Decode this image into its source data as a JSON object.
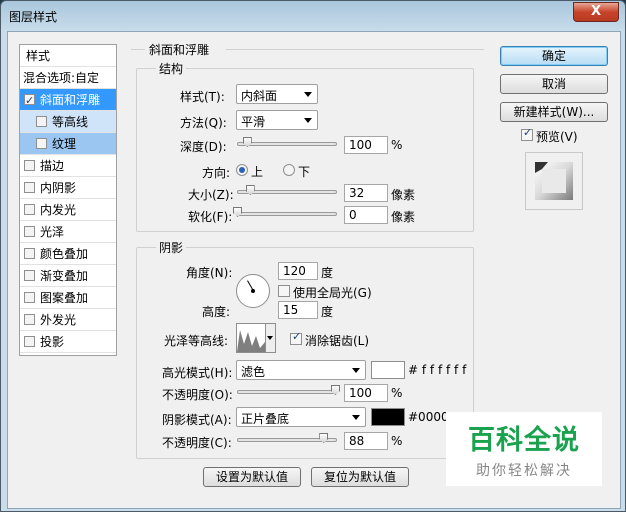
{
  "window": {
    "title": "图层样式",
    "close_label": "X"
  },
  "left_panel": {
    "header": "样式",
    "blend_options": "混合选项:自定",
    "items": [
      {
        "label": "斜面和浮雕",
        "checked": true
      },
      {
        "label": "等高线",
        "checked": false
      },
      {
        "label": "纹理",
        "checked": false
      },
      {
        "label": "描边",
        "checked": false
      },
      {
        "label": "内阴影",
        "checked": false
      },
      {
        "label": "内发光",
        "checked": false
      },
      {
        "label": "光泽",
        "checked": false
      },
      {
        "label": "颜色叠加",
        "checked": false
      },
      {
        "label": "渐变叠加",
        "checked": false
      },
      {
        "label": "图案叠加",
        "checked": false
      },
      {
        "label": "外发光",
        "checked": false
      },
      {
        "label": "投影",
        "checked": false
      }
    ]
  },
  "bevel": {
    "section_title": "斜面和浮雕",
    "structure": {
      "title": "结构",
      "style_label": "样式(T):",
      "style_value": "内斜面",
      "technique_label": "方法(Q):",
      "technique_value": "平滑",
      "depth_label": "深度(D):",
      "depth_value": "100",
      "depth_unit": "%",
      "depth_slider": 0.1,
      "direction_label": "方向:",
      "direction_up": "上",
      "direction_down": "下",
      "direction_selected": "up",
      "size_label": "大小(Z):",
      "size_value": "32",
      "size_unit": "像素",
      "size_slider": 0.13,
      "soften_label": "软化(F):",
      "soften_value": "0",
      "soften_unit": "像素",
      "soften_slider": 0.0
    },
    "shading": {
      "title": "阴影",
      "angle_label": "角度(N):",
      "angle_value": "120",
      "angle_unit": "度",
      "global_light_label": "使用全局光(G)",
      "global_light_checked": false,
      "altitude_label": "高度:",
      "altitude_value": "15",
      "altitude_unit": "度",
      "gloss_contour_label": "光泽等高线:",
      "anti_alias_label": "消除锯齿(L)",
      "anti_alias_checked": true,
      "highlight_mode_label": "高光模式(H):",
      "highlight_mode_value": "滤色",
      "highlight_color": "#ffffff",
      "highlight_color_text": "# f f f f f f",
      "highlight_opacity_label": "不透明度(O):",
      "highlight_opacity_value": "100",
      "highlight_opacity_unit": "%",
      "highlight_opacity_slider": 1.0,
      "shadow_mode_label": "阴影模式(A):",
      "shadow_mode_value": "正片叠底",
      "shadow_color": "#000000",
      "shadow_color_text": "#0000",
      "shadow_opacity_label": "不透明度(C):",
      "shadow_opacity_value": "88",
      "shadow_opacity_unit": "%",
      "shadow_opacity_slider": 0.88
    },
    "make_default": "设置为默认值",
    "reset_default": "复位为默认值"
  },
  "right_panel": {
    "ok": "确定",
    "cancel": "取消",
    "new_style": "新建样式(W)...",
    "preview_label": "预览(V)",
    "preview_checked": true
  },
  "watermark": {
    "main": "百科全说",
    "sub": "助你轻松解决"
  }
}
